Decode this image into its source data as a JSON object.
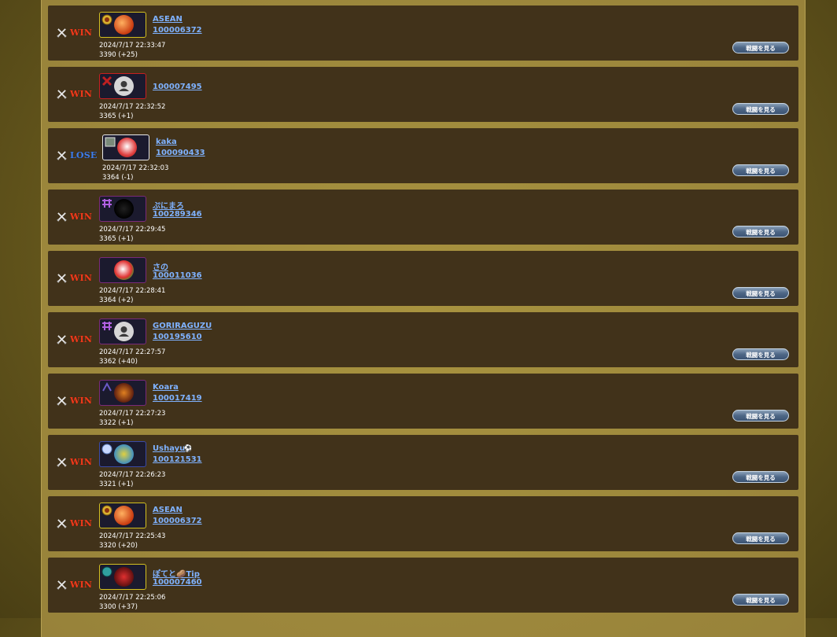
{
  "battle_button_label": "戦闘を見る",
  "history": [
    {
      "result": "WIN",
      "name": "ASEAN",
      "id": "100006372",
      "datetime": "2024/7/17 22:33:47",
      "rate": "3390 (+25)"
    },
    {
      "result": "WIN",
      "name": "",
      "id": "100007495",
      "datetime": "2024/7/17 22:32:52",
      "rate": "3365 (+1)"
    },
    {
      "result": "LOSE",
      "name": "kaka",
      "id": "100090433",
      "datetime": "2024/7/17 22:32:03",
      "rate": "3364 (-1)"
    },
    {
      "result": "WIN",
      "name": "ぷにまろ",
      "id": "100289346",
      "datetime": "2024/7/17 22:29:45",
      "rate": "3365 (+1)"
    },
    {
      "result": "WIN",
      "name": "さの",
      "id": "100011036",
      "datetime": "2024/7/17 22:28:41",
      "rate": "3364 (+2)"
    },
    {
      "result": "WIN",
      "name": "GORIRAGUZU",
      "id": "100195610",
      "datetime": "2024/7/17 22:27:57",
      "rate": "3362 (+40)"
    },
    {
      "result": "WIN",
      "name": "Koara",
      "id": "100017419",
      "datetime": "2024/7/17 22:27:23",
      "rate": "3322 (+1)"
    },
    {
      "result": "WIN",
      "name": "Ushayu",
      "id": "100121531",
      "datetime": "2024/7/17 22:26:23",
      "rate": "3321 (+1)"
    },
    {
      "result": "WIN",
      "name": "ASEAN",
      "id": "100006372",
      "datetime": "2024/7/17 22:25:43",
      "rate": "3320 (+20)"
    },
    {
      "result": "WIN",
      "name": "ぽてと🥔Tip",
      "id": "100007460",
      "datetime": "2024/7/17 22:25:06",
      "rate": "3300 (+37)"
    }
  ],
  "colors": {
    "win": "#ee3a1c",
    "lose": "#3f7ee8",
    "link": "#7fb2ff",
    "row_bg": "#41321a"
  }
}
